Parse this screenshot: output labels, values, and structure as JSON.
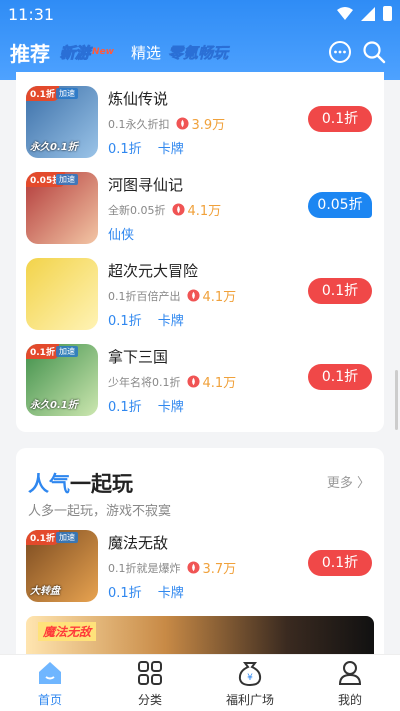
{
  "status_bar": {
    "time": "11:31"
  },
  "header": {
    "tabs": [
      {
        "label": "推荐"
      },
      {
        "label": "新游"
      },
      {
        "label": "精选"
      },
      {
        "label": "零氪畅玩"
      }
    ],
    "new_badge": "New"
  },
  "games": [
    {
      "name": "炼仙传说",
      "subtitle": "0.1永久折扣",
      "rating": "3.9万",
      "tags": [
        "0.1折",
        "卡牌"
      ],
      "discount": "0.1折",
      "discount_style": "red",
      "icon_tag": "0.1折",
      "icon_tag2": "加速",
      "icon_caption": "永久0.1折",
      "icon_colors": [
        "#3b6fa8",
        "#9bc4e8"
      ]
    },
    {
      "name": "河图寻仙记",
      "subtitle": "全新0.05折",
      "rating": "4.1万",
      "tags": [
        "仙侠"
      ],
      "discount": "0.05折",
      "discount_style": "blue",
      "icon_tag": "0.05折",
      "icon_tag2": "加速",
      "icon_caption": "",
      "icon_colors": [
        "#b23a3a",
        "#f3c6a5"
      ]
    },
    {
      "name": "超次元大冒险",
      "subtitle": "0.1折百倍产出",
      "rating": "4.1万",
      "tags": [
        "0.1折",
        "卡牌"
      ],
      "discount": "0.1折",
      "discount_style": "red",
      "icon_tag": "",
      "icon_tag2": "",
      "icon_caption": "",
      "icon_colors": [
        "#f2d34a",
        "#fff3b5"
      ]
    },
    {
      "name": "拿下三国",
      "subtitle": "少年名将0.1折",
      "rating": "4.1万",
      "tags": [
        "0.1折",
        "卡牌"
      ],
      "discount": "0.1折",
      "discount_style": "red",
      "icon_tag": "0.1折",
      "icon_tag2": "加速",
      "icon_caption": "永久0.1折",
      "icon_colors": [
        "#3f8f4a",
        "#cde7b0"
      ]
    }
  ],
  "section": {
    "title_highlight": "人气",
    "title_rest": "一起玩",
    "subtitle": "人多一起玩，游戏不寂寞",
    "more_label": "更多 〉",
    "game": {
      "name": "魔法无敌",
      "subtitle": "0.1折就是爆炸",
      "rating": "3.7万",
      "tags": [
        "0.1折",
        "卡牌"
      ],
      "discount": "0.1折",
      "icon_tag": "0.1折",
      "icon_tag2": "加速",
      "icon_caption": "大转盘",
      "icon_colors": [
        "#7a4a20",
        "#e8a350"
      ]
    },
    "banner_text": "魔法无敌"
  },
  "bottom_nav": [
    {
      "label": "首页",
      "active": true
    },
    {
      "label": "分类",
      "active": false
    },
    {
      "label": "福利广场",
      "active": false
    },
    {
      "label": "我的",
      "active": false
    }
  ],
  "colors": {
    "primary": "#2f87ef",
    "discount_red": "#f04848",
    "rating": "#f0a13b"
  }
}
